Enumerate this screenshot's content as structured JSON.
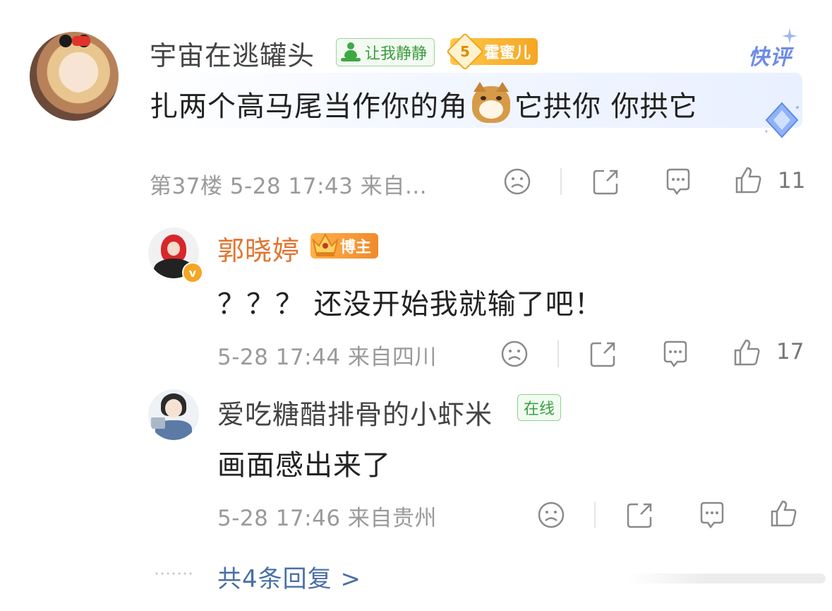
{
  "main_comment": {
    "username": "宇宙在逃罐头",
    "status_badge": "让我静静",
    "fan_badge": {
      "level": "5",
      "label": "霍蜜儿"
    },
    "quick_review_label": "快评",
    "text_before_emoji": "扎两个高马尾当作你的角",
    "text_after_emoji": "它拱你 你拱它",
    "meta": "第37楼 5-28 17:43 来自…",
    "like_count": "11"
  },
  "replies": [
    {
      "username": "郭晓婷",
      "role_badge": "博主",
      "verified_mark": "v",
      "text": "？？？ 还没开始我就输了吧！",
      "meta": "5-28 17:44 来自四川",
      "like_count": "17"
    },
    {
      "username": "爱吃糖醋排骨的小虾米",
      "online_badge": "在线",
      "text": "画面感出来了",
      "meta": "5-28 17:46 来自贵州",
      "like_count": ""
    }
  ],
  "more_replies_label": "共4条回复 >",
  "colors": {
    "username_host": "#e0752f",
    "link_blue": "#4a6fa8",
    "meta_gray": "#9a9a9a",
    "badge_green": "#3a9d3e",
    "badge_orange": "#f5a623"
  }
}
